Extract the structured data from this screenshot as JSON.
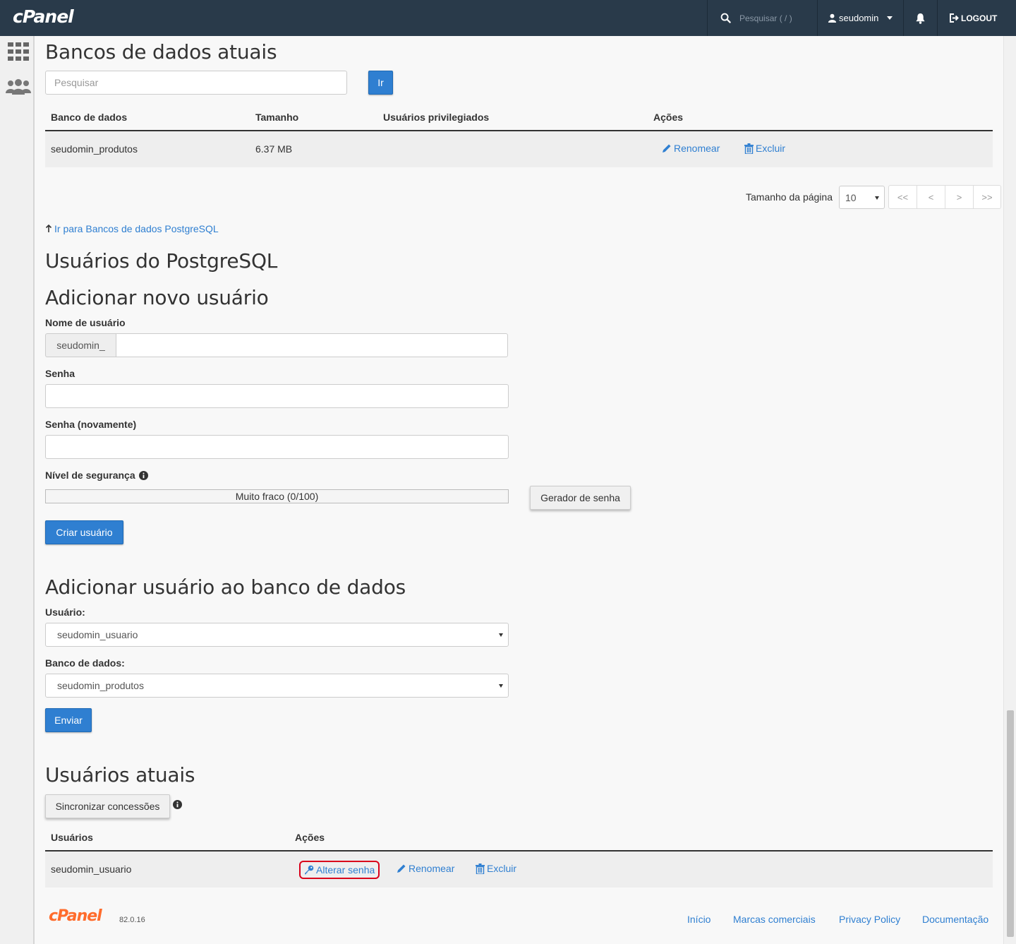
{
  "topbar": {
    "logo": "cPanel",
    "search_placeholder": "Pesquisar ( / )",
    "username": "seudomin",
    "logout": "LOGOUT"
  },
  "databases": {
    "title": "Bancos de dados atuais",
    "search_placeholder": "Pesquisar",
    "go_label": "Ir",
    "columns": [
      "Banco de dados",
      "Tamanho",
      "Usuários privilegiados",
      "Ações"
    ],
    "rows": [
      {
        "name": "seudomin_produtos",
        "size": "6.37 MB",
        "users": "",
        "rename": "Renomear",
        "delete": "Excluir"
      }
    ],
    "page_size_label": "Tamanho da página",
    "page_size": "10",
    "pager": [
      "<<",
      "<",
      ">",
      ">>"
    ],
    "jump_link": "Ir para Bancos de dados PostgreSQL"
  },
  "pg_users": {
    "title": "Usuários do PostgreSQL"
  },
  "add_user": {
    "title": "Adicionar novo usuário",
    "username_label": "Nome de usuário",
    "username_prefix": "seudomin_",
    "password_label": "Senha",
    "password_again_label": "Senha (novamente)",
    "strength_label": "Nível de segurança",
    "strength_text": "Muito fraco (0/100)",
    "strength_value": 0,
    "generator_label": "Gerador de senha",
    "create_label": "Criar usuário"
  },
  "add_user_to_db": {
    "title": "Adicionar usuário ao banco de dados",
    "user_label": "Usuário:",
    "user_value": "seudomin_usuario",
    "db_label": "Banco de dados:",
    "db_value": "seudomin_produtos",
    "submit_label": "Enviar"
  },
  "current_users": {
    "title": "Usuários atuais",
    "sync_label": "Sincronizar concessões",
    "columns": [
      "Usuários",
      "Ações"
    ],
    "rows": [
      {
        "name": "seudomin_usuario",
        "change_password": "Alterar senha",
        "rename": "Renomear",
        "delete": "Excluir"
      }
    ],
    "highlight_color": "#d9001b"
  },
  "footer": {
    "logo": "cPanel",
    "version": "82.0.16",
    "links": [
      "Início",
      "Marcas comerciais",
      "Privacy Policy",
      "Documentação"
    ]
  }
}
